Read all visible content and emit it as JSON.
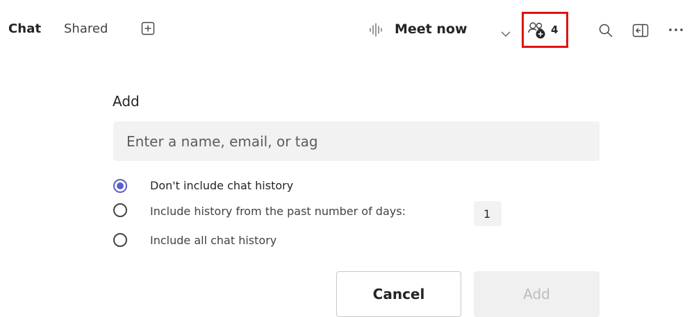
{
  "header": {
    "tabs": [
      {
        "label": "Chat",
        "active": true
      },
      {
        "label": "Shared",
        "active": false
      }
    ],
    "add_tab_icon": "plus-square-icon",
    "meet_icon": "waveform-icon",
    "meet_label": "Meet now",
    "meet_chevron_icon": "chevron-down-icon",
    "people_icon": "people-add-icon",
    "people_count": "4",
    "highlight_color": "#e11212",
    "search_icon": "search-icon",
    "panel_icon": "side-panel-icon",
    "more_icon": "more-horizontal-icon"
  },
  "add_panel": {
    "title": "Add",
    "input_placeholder": "Enter a name, email, or tag",
    "input_value": "",
    "history_options": [
      {
        "label": "Don't include chat history",
        "selected": true
      },
      {
        "label": "Include history from the past number of days:",
        "selected": false
      },
      {
        "label": "Include all chat history",
        "selected": false
      }
    ],
    "days_value": "1",
    "accent_color": "#5b5fc7",
    "cancel_label": "Cancel",
    "add_label": "Add",
    "add_disabled": true
  }
}
